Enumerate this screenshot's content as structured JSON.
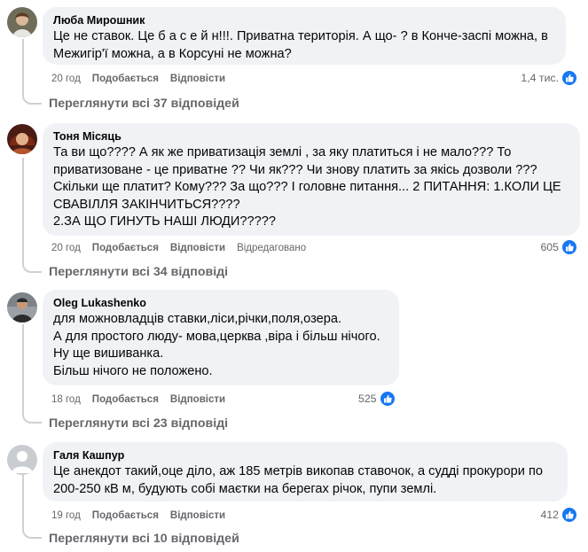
{
  "comments": [
    {
      "author": "Люба Мирошник",
      "lines": [
        "Це не ставок. Це б а с е й н!!!. Приватна територія. А що- ? в Конче-заспі можна, в",
        "Межигір'ї можна, а в Корсуні не можна?"
      ],
      "time": "20 год",
      "share": "Подобається",
      "reply": "Відповісти",
      "edited": "",
      "reactions": "1,4 тис.",
      "view_replies": "Переглянути всі 37 відповідей"
    },
    {
      "author": "Тоня Місяць",
      "lines": [
        "Та ви що???? А як же приватизація землі , за яку платиться і не мало??? То",
        "приватизоване - це приватне ?? Чи як??? Чи знову платить за якісь дозволи ???",
        "Скільки ще платит? Кому??? За що??? І головне питання... 2 ПИТАННЯ: 1.КОЛИ ЦЕ",
        "СВАВІЛЛЯ ЗАКІНЧИТЬСЯ????",
        "2.ЗА ЩО ГИНУТЬ НАШІ ЛЮДИ?????"
      ],
      "time": "20 год",
      "share": "Подобається",
      "reply": "Відповісти",
      "edited": "Відредаговано",
      "reactions": "605",
      "view_replies": "Переглянути всі 34 відповіді"
    },
    {
      "author": "Oleg Lukashenko",
      "lines": [
        "для можновладців ставки,ліси,річки,поля,озера.",
        "А для простого люду- мова,церква ,віра і більш нічого.",
        "Ну ще вишиванка.",
        "Більш нічого не положено."
      ],
      "time": "18 год",
      "share": "Подобається",
      "reply": "Відповісти",
      "edited": "",
      "reactions": "525",
      "view_replies": "Переглянути всі 23 відповіді"
    },
    {
      "author": "Галя Кашпур",
      "lines": [
        "Це анекдот такий,оце діло, аж 185 метрів викопав ставочок, а судді прокурори по",
        "200-250 кВ м, будують собі маєтки на берегах річок, пупи землі."
      ],
      "time": "19 год",
      "share": "Подобається",
      "reply": "Відповісти",
      "edited": "",
      "reactions": "412",
      "view_replies": "Переглянути всі 10 відповідей"
    }
  ],
  "colors": {
    "bubble": "#f0f2f5",
    "meta": "#65676b",
    "like": "#1877f2",
    "line": "#ced0d4"
  },
  "icons": {
    "like": "thumbs-up-icon"
  }
}
